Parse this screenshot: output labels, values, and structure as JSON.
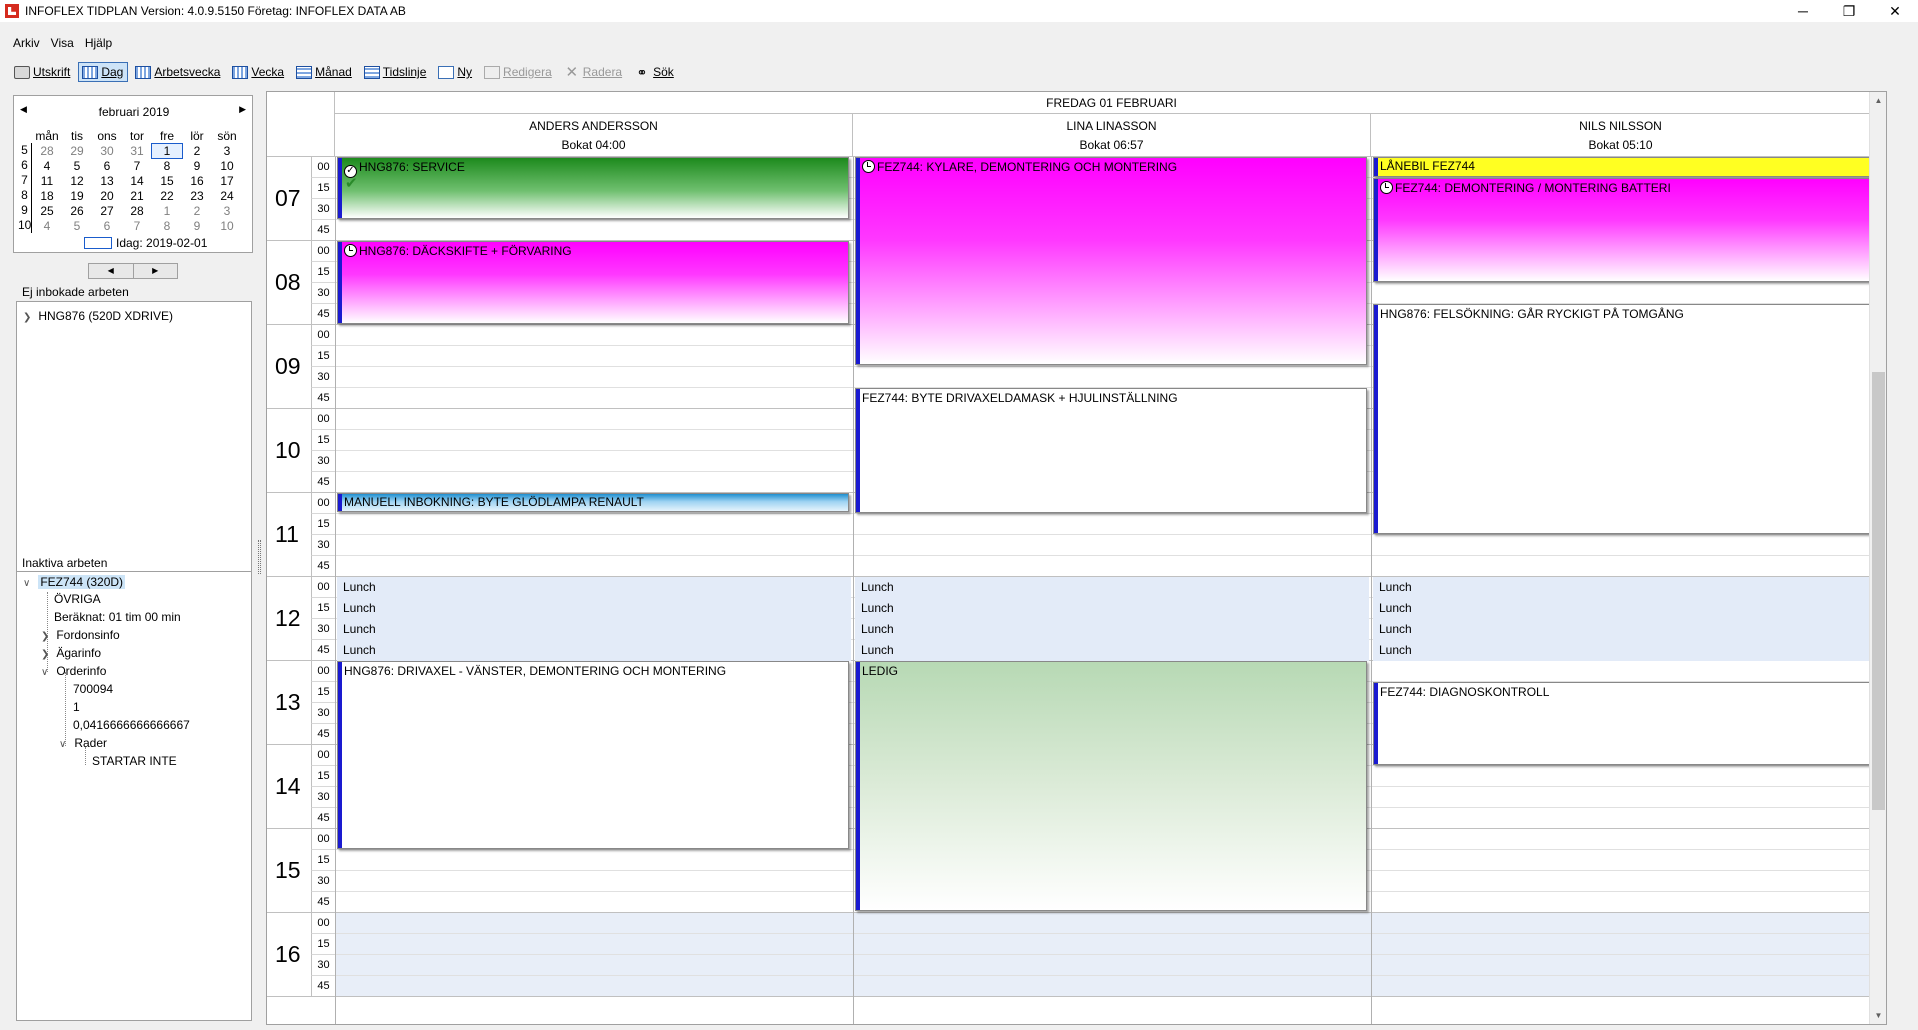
{
  "window": {
    "title": "INFOFLEX TIDPLAN Version: 4.0.9.5150  Företag: INFOFLEX DATA AB",
    "minimize": "─",
    "restore": "❐",
    "close": "✕"
  },
  "menu": [
    "Arkiv",
    "Visa",
    "Hjälp"
  ],
  "toolbar": {
    "print": "Utskrift",
    "day": "Dag",
    "workweek": "Arbetsvecka",
    "week": "Vecka",
    "month": "Månad",
    "timeline": "Tidslinje",
    "new": "Ny",
    "edit": "Redigera",
    "delete": "Radera",
    "search": "Sök"
  },
  "calendar": {
    "month_label": "februari 2019",
    "prev": "◀",
    "next": "▶",
    "weekdays": [
      "mån",
      "tis",
      "ons",
      "tor",
      "fre",
      "lör",
      "sön"
    ],
    "weeks": [
      {
        "wk": "5",
        "days": [
          "28",
          "29",
          "30",
          "31",
          "1",
          "2",
          "3"
        ]
      },
      {
        "wk": "6",
        "days": [
          "4",
          "5",
          "6",
          "7",
          "8",
          "9",
          "10"
        ]
      },
      {
        "wk": "7",
        "days": [
          "11",
          "12",
          "13",
          "14",
          "15",
          "16",
          "17"
        ]
      },
      {
        "wk": "8",
        "days": [
          "18",
          "19",
          "20",
          "21",
          "22",
          "23",
          "24"
        ]
      },
      {
        "wk": "9",
        "days": [
          "25",
          "26",
          "27",
          "28",
          "1",
          "2",
          "3"
        ]
      },
      {
        "wk": "10",
        "days": [
          "4",
          "5",
          "6",
          "7",
          "8",
          "9",
          "10"
        ]
      }
    ],
    "today_label": "Idag: 2019-02-01",
    "nav_prev": "◀",
    "nav_next": "▶"
  },
  "unbooked": {
    "label": "Ej inbokade arbeten",
    "items": [
      "HNG876  (520D XDRIVE)"
    ]
  },
  "inactive": {
    "label": "Inaktiva arbeten",
    "root": "FEZ744  (320D)",
    "ovriga": "ÖVRIGA",
    "beraknat": "Beräknat: 01 tim 00 min",
    "fordonsinfo": "Fordonsinfo",
    "agarinfo": "Ägarinfo",
    "orderinfo": "Orderinfo",
    "order_values": [
      "700094",
      "1",
      "0,0416666666666667"
    ],
    "rader": "Rader",
    "rad_item": "STARTAR INTE"
  },
  "schedule": {
    "date": "FREDAG 01 FEBRUARI",
    "resources": [
      {
        "name": "ANDERS ANDERSSON",
        "booked": "Bokat 04:00"
      },
      {
        "name": "LINA LINASSON",
        "booked": "Bokat 06:57"
      },
      {
        "name": "NILS NILSSON",
        "booked": "Bokat 05:10"
      }
    ],
    "hours": [
      "07",
      "08",
      "09",
      "10",
      "11",
      "12",
      "13",
      "14",
      "15",
      "16"
    ],
    "minutes": [
      "00",
      "15",
      "30",
      "45"
    ],
    "lunch_label": "Lunch",
    "appointments": {
      "a1": "HNG876: SERVICE",
      "a2": "HNG876: DÄCKSKIFTE + FÖRVARING",
      "a3": "MANUELL INBOKNING: BYTE GLÖDLAMPA RENAULT",
      "a4": "HNG876: DRIVAXEL - VÄNSTER, DEMONTERING OCH MONTERING",
      "l1": "FEZ744: KYLARE, DEMONTERING OCH MONTERING",
      "l2": "FEZ744: BYTE DRIVAXELDAMASK + HJULINSTÄLLNING",
      "l3": "LEDIG",
      "n1": "LÅNEBIL FEZ744",
      "n2": "FEZ744: DEMONTERING / MONTERING BATTERI",
      "n3": "HNG876: FELSÖKNING: GÅR RYCKIGT PÅ TOMGÅNG",
      "n4": "FEZ744: DIAGNOSKONTROLL"
    }
  }
}
